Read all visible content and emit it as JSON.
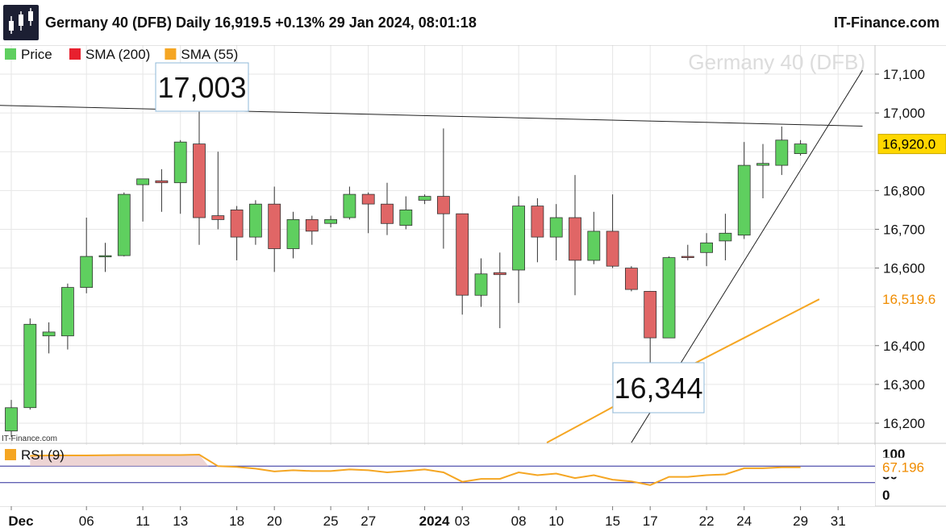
{
  "header": {
    "title": "Germany 40 (DFB) Daily 16,919.5 +0.13% 29 Jan 2024, 08:01:18",
    "brand": "IT-Finance.com"
  },
  "colors": {
    "up": "#5fcf5f",
    "down": "#e06666",
    "sma55": "#f5a623",
    "sma200": "#e8202e",
    "grid": "#e6e6e6",
    "rsi": "#f5a623",
    "rsi_lines": "#2a2a9a",
    "last_price_bg": "#ffd700"
  },
  "chart_data": [
    {
      "type": "candlestick",
      "title": "Germany 40 (DFB)",
      "watermark": "Germany 40 (DFB)",
      "source_note": "IT-Finance.com",
      "legend": [
        {
          "name": "Price",
          "color": "#5fcf5f"
        },
        {
          "name": "SMA (200)",
          "color": "#e8202e"
        },
        {
          "name": "SMA (55)",
          "color": "#f5a623"
        }
      ],
      "legend_position": "top-left",
      "grid": true,
      "ylim": [
        16150,
        17150
      ],
      "y_ticks": [
        {
          "v": 16200,
          "label": "16,200"
        },
        {
          "v": 16300,
          "label": "16,300"
        },
        {
          "v": 16400,
          "label": "16,400"
        },
        {
          "v": 16600,
          "label": "16,600"
        },
        {
          "v": 16700,
          "label": "16,700"
        },
        {
          "v": 16800,
          "label": "16,800"
        },
        {
          "v": 17000,
          "label": "17,000"
        },
        {
          "v": 17100,
          "label": "17,100"
        }
      ],
      "x_ticks": [
        {
          "i": 0,
          "label": "Dec",
          "bold": true
        },
        {
          "i": 4,
          "label": "06"
        },
        {
          "i": 7,
          "label": "11"
        },
        {
          "i": 9,
          "label": "13"
        },
        {
          "i": 12,
          "label": "18"
        },
        {
          "i": 14,
          "label": "20"
        },
        {
          "i": 17,
          "label": "25"
        },
        {
          "i": 19,
          "label": "27"
        },
        {
          "i": 22,
          "label": "2024",
          "bold": true
        },
        {
          "i": 24,
          "label": "03"
        },
        {
          "i": 27,
          "label": "08"
        },
        {
          "i": 29,
          "label": "10"
        },
        {
          "i": 32,
          "label": "15"
        },
        {
          "i": 34,
          "label": "17"
        },
        {
          "i": 37,
          "label": "22"
        },
        {
          "i": 39,
          "label": "24"
        },
        {
          "i": 42,
          "label": "29"
        },
        {
          "i": 44,
          "label": "31"
        }
      ],
      "candles": [
        {
          "o": 16180,
          "h": 16260,
          "l": 16165,
          "c": 16240
        },
        {
          "o": 16240,
          "h": 16470,
          "l": 16235,
          "c": 16455
        },
        {
          "o": 16425,
          "h": 16460,
          "l": 16380,
          "c": 16435
        },
        {
          "o": 16425,
          "h": 16560,
          "l": 16390,
          "c": 16550
        },
        {
          "o": 16550,
          "h": 16730,
          "l": 16535,
          "c": 16630
        },
        {
          "o": 16630,
          "h": 16665,
          "l": 16590,
          "c": 16632
        },
        {
          "o": 16632,
          "h": 16795,
          "l": 16630,
          "c": 16790
        },
        {
          "o": 16815,
          "h": 16830,
          "l": 16720,
          "c": 16830
        },
        {
          "o": 16825,
          "h": 16855,
          "l": 16745,
          "c": 16820
        },
        {
          "o": 16820,
          "h": 16930,
          "l": 16740,
          "c": 16925
        },
        {
          "o": 16920,
          "h": 17003,
          "l": 16660,
          "c": 16730
        },
        {
          "o": 16735,
          "h": 16900,
          "l": 16700,
          "c": 16725
        },
        {
          "o": 16750,
          "h": 16760,
          "l": 16620,
          "c": 16680
        },
        {
          "o": 16680,
          "h": 16775,
          "l": 16660,
          "c": 16765
        },
        {
          "o": 16765,
          "h": 16810,
          "l": 16590,
          "c": 16650
        },
        {
          "o": 16650,
          "h": 16745,
          "l": 16625,
          "c": 16725
        },
        {
          "o": 16725,
          "h": 16735,
          "l": 16660,
          "c": 16695
        },
        {
          "o": 16715,
          "h": 16735,
          "l": 16705,
          "c": 16725
        },
        {
          "o": 16730,
          "h": 16810,
          "l": 16725,
          "c": 16790
        },
        {
          "o": 16790,
          "h": 16795,
          "l": 16690,
          "c": 16765
        },
        {
          "o": 16765,
          "h": 16820,
          "l": 16685,
          "c": 16715
        },
        {
          "o": 16710,
          "h": 16785,
          "l": 16700,
          "c": 16750
        },
        {
          "o": 16775,
          "h": 16790,
          "l": 16765,
          "c": 16785
        },
        {
          "o": 16785,
          "h": 16960,
          "l": 16650,
          "c": 16740
        },
        {
          "o": 16740,
          "h": 16740,
          "l": 16480,
          "c": 16530
        },
        {
          "o": 16530,
          "h": 16625,
          "l": 16500,
          "c": 16585
        },
        {
          "o": 16588,
          "h": 16640,
          "l": 16445,
          "c": 16583
        },
        {
          "o": 16595,
          "h": 16785,
          "l": 16510,
          "c": 16760
        },
        {
          "o": 16760,
          "h": 16780,
          "l": 16615,
          "c": 16680
        },
        {
          "o": 16680,
          "h": 16765,
          "l": 16620,
          "c": 16730
        },
        {
          "o": 16730,
          "h": 16840,
          "l": 16530,
          "c": 16620
        },
        {
          "o": 16620,
          "h": 16745,
          "l": 16610,
          "c": 16695
        },
        {
          "o": 16695,
          "h": 16790,
          "l": 16600,
          "c": 16605
        },
        {
          "o": 16600,
          "h": 16605,
          "l": 16540,
          "c": 16545
        },
        {
          "o": 16540,
          "h": 16540,
          "l": 16344,
          "c": 16420
        },
        {
          "o": 16420,
          "h": 16630,
          "l": 16420,
          "c": 16627
        },
        {
          "o": 16630,
          "h": 16660,
          "l": 16620,
          "c": 16627
        },
        {
          "o": 16640,
          "h": 16690,
          "l": 16605,
          "c": 16665
        },
        {
          "o": 16670,
          "h": 16740,
          "l": 16620,
          "c": 16690
        },
        {
          "o": 16685,
          "h": 16925,
          "l": 16675,
          "c": 16865
        },
        {
          "o": 16865,
          "h": 16920,
          "l": 16780,
          "c": 16870
        },
        {
          "o": 16865,
          "h": 16965,
          "l": 16840,
          "c": 16930
        },
        {
          "o": 16895,
          "h": 16930,
          "l": 16890,
          "c": 16920
        }
      ],
      "sma55": [
        {
          "i": 28.5,
          "v": 16150
        },
        {
          "i": 31,
          "v": 16215
        },
        {
          "i": 33,
          "v": 16268
        },
        {
          "i": 35,
          "v": 16320
        },
        {
          "i": 37,
          "v": 16370
        },
        {
          "i": 39,
          "v": 16420
        },
        {
          "i": 41,
          "v": 16470
        },
        {
          "i": 43,
          "v": 16519.6
        }
      ],
      "resistance_line": {
        "i1": -1,
        "v1": 17020,
        "i2": 45.3,
        "v2": 16966
      },
      "support_line": {
        "i1": 33,
        "v1": 16150,
        "i2": 45.3,
        "v2": 17110
      },
      "annotations": [
        {
          "text": "17,003",
          "i": 10,
          "v": 17003,
          "box_left": 193,
          "box_top": 78,
          "box_w": 115,
          "box_h": 60
        },
        {
          "text": "16,344",
          "i": 34,
          "v": 16344,
          "box_left": 760,
          "box_top": 450,
          "box_w": 113,
          "box_h": 62
        }
      ],
      "labels_right": [
        {
          "v": 16920,
          "text": "16,920.0",
          "bg": "#ffd700",
          "color": "#000000"
        },
        {
          "v": 16519.6,
          "text": "16,519.6",
          "bg": "#ffffff",
          "color": "#f08c00"
        }
      ]
    },
    {
      "type": "line",
      "title": "RSI (9)",
      "legend": [
        {
          "name": "RSI (9)",
          "color": "#f5a623"
        }
      ],
      "ylim": [
        0,
        100
      ],
      "y_ticks": [
        {
          "v": 100,
          "label": "100"
        },
        {
          "v": 50,
          "label": "50"
        },
        {
          "v": 0,
          "label": "0"
        }
      ],
      "levels": [
        70,
        30
      ],
      "last_value": 67.196,
      "last_label": "67.196",
      "points": [
        {
          "i": 1,
          "v": 95
        },
        {
          "i": 2,
          "v": 96
        },
        {
          "i": 4,
          "v": 96
        },
        {
          "i": 6,
          "v": 97
        },
        {
          "i": 9,
          "v": 97
        },
        {
          "i": 10,
          "v": 98
        },
        {
          "i": 11,
          "v": 70
        },
        {
          "i": 12,
          "v": 68
        },
        {
          "i": 13,
          "v": 64
        },
        {
          "i": 14,
          "v": 57
        },
        {
          "i": 15,
          "v": 60
        },
        {
          "i": 16,
          "v": 58
        },
        {
          "i": 17,
          "v": 58
        },
        {
          "i": 18,
          "v": 62
        },
        {
          "i": 19,
          "v": 60
        },
        {
          "i": 20,
          "v": 55
        },
        {
          "i": 21,
          "v": 58
        },
        {
          "i": 22,
          "v": 62
        },
        {
          "i": 23,
          "v": 55
        },
        {
          "i": 24,
          "v": 32
        },
        {
          "i": 25,
          "v": 39
        },
        {
          "i": 26,
          "v": 39
        },
        {
          "i": 27,
          "v": 55
        },
        {
          "i": 28,
          "v": 48
        },
        {
          "i": 29,
          "v": 52
        },
        {
          "i": 30,
          "v": 41
        },
        {
          "i": 31,
          "v": 48
        },
        {
          "i": 32,
          "v": 37
        },
        {
          "i": 33,
          "v": 33
        },
        {
          "i": 34,
          "v": 24
        },
        {
          "i": 35,
          "v": 44
        },
        {
          "i": 36,
          "v": 44
        },
        {
          "i": 37,
          "v": 48
        },
        {
          "i": 38,
          "v": 50
        },
        {
          "i": 39,
          "v": 65
        },
        {
          "i": 40,
          "v": 65
        },
        {
          "i": 41,
          "v": 67
        },
        {
          "i": 42,
          "v": 67.196
        }
      ]
    }
  ]
}
